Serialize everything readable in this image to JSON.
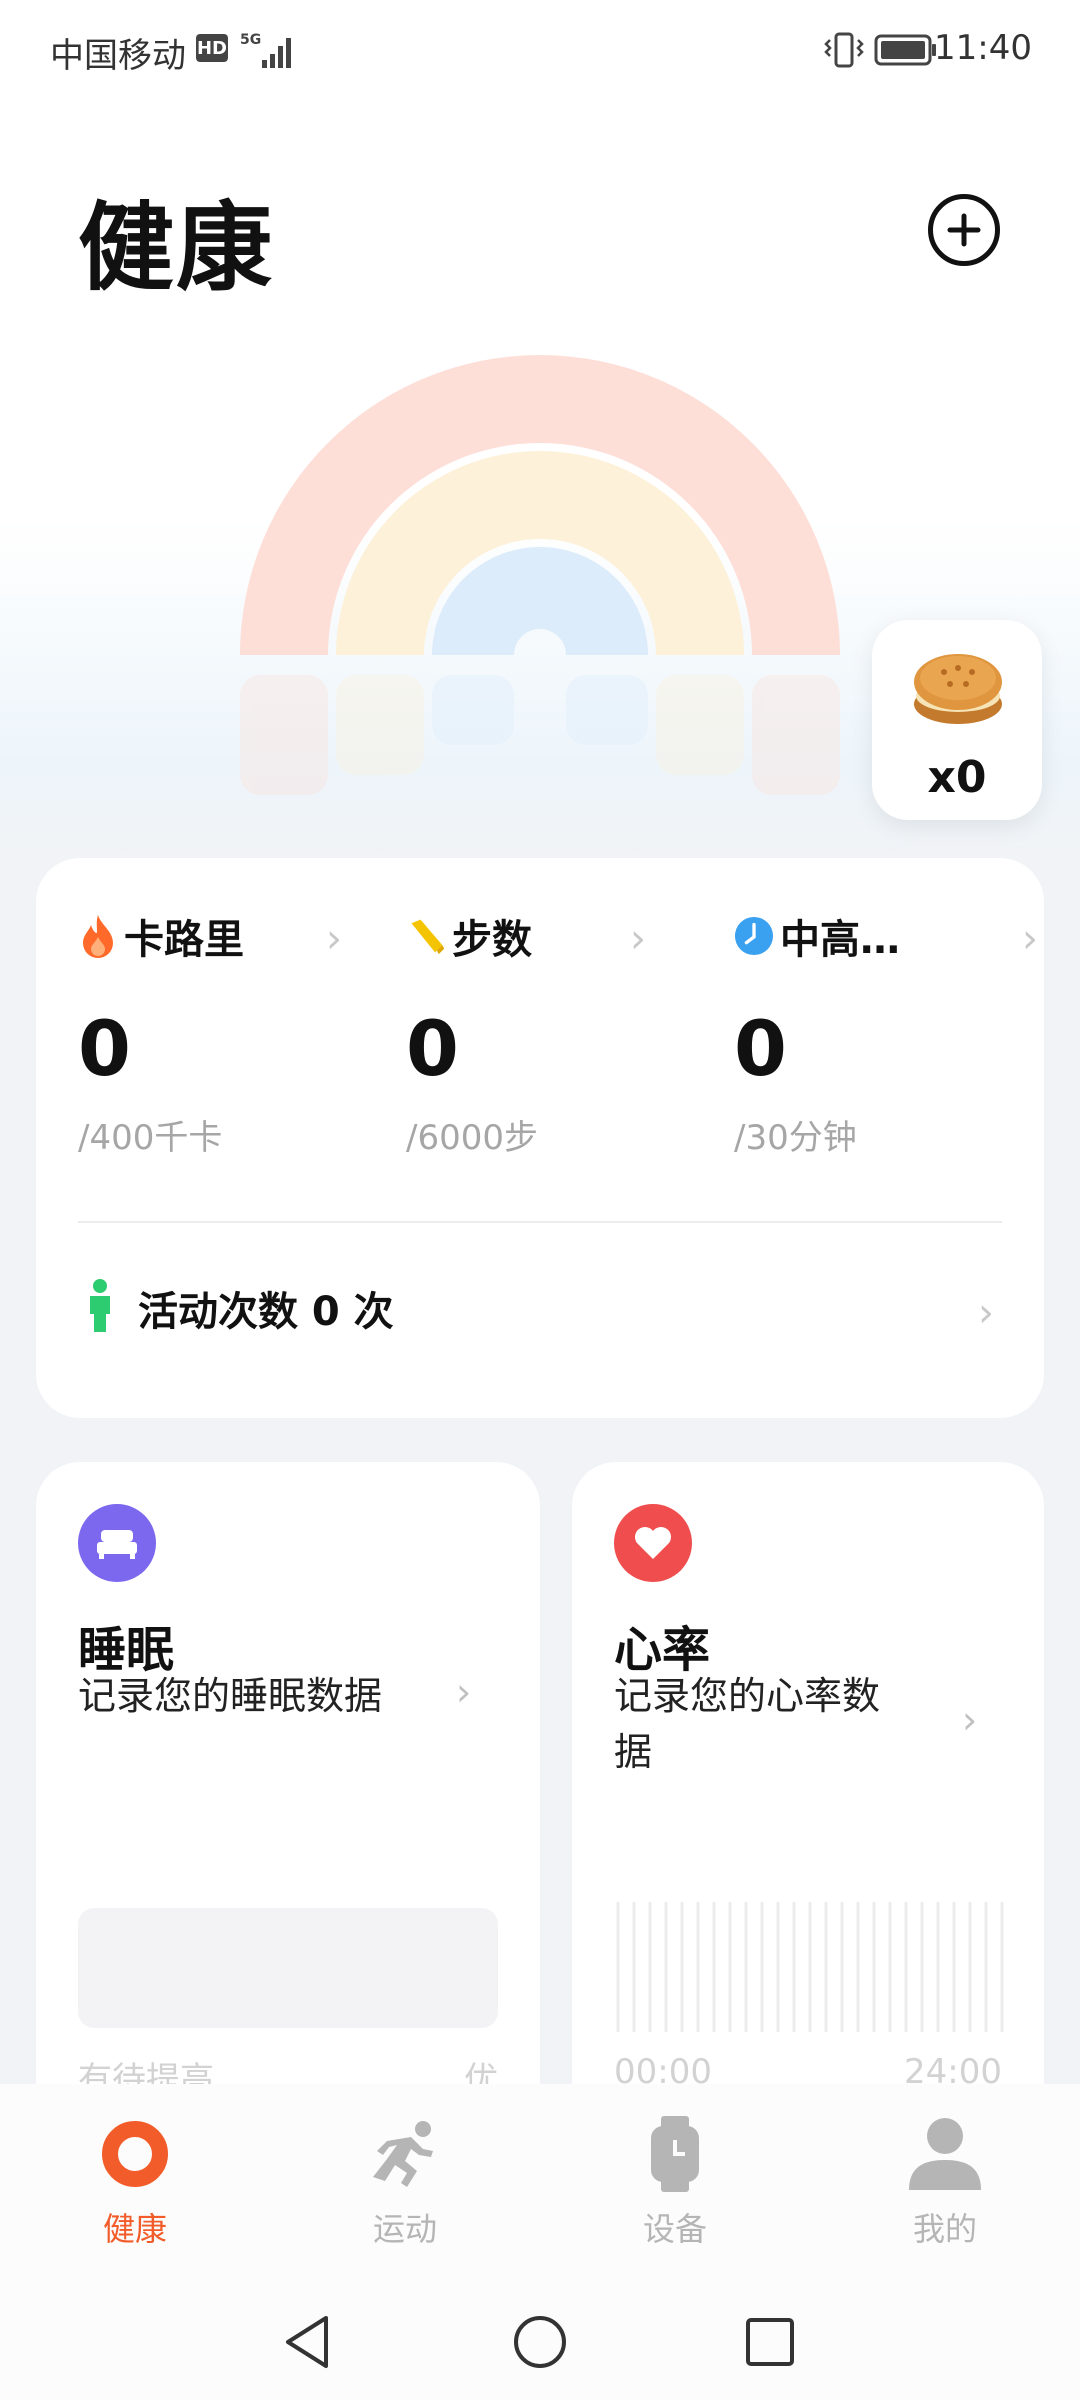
{
  "status_bar": {
    "carrier": "中国移动",
    "hd": "HD",
    "network": "5G",
    "time": "11:40"
  },
  "header": {
    "title": "健康"
  },
  "badge": {
    "count": "x0"
  },
  "activity": {
    "metrics": [
      {
        "label": "卡路里",
        "value": "0",
        "goal": "/400千卡"
      },
      {
        "label": "步数",
        "value": "0",
        "goal": "/6000步"
      },
      {
        "label": "中高…",
        "value": "0",
        "goal": "/30分钟"
      }
    ],
    "count_text": "活动次数 0 次"
  },
  "sleep": {
    "title": "睡眠",
    "desc": "记录您的睡眠数据",
    "low_label": "有待提高",
    "high_label": "优"
  },
  "heart": {
    "title": "心率",
    "desc_line1": "记录您的心率数",
    "desc_line2": "据",
    "start_label": "00:00",
    "end_label": "24:00"
  },
  "tabs": [
    {
      "label": "健康",
      "active": true
    },
    {
      "label": "运动",
      "active": false
    },
    {
      "label": "设备",
      "active": false
    },
    {
      "label": "我的",
      "active": false
    }
  ],
  "colors": {
    "accent": "#f25c2a",
    "calorie": "#ff6a2b",
    "steps": "#f5c400",
    "intensity": "#3aa0f0",
    "activity": "#2ecc71",
    "sleep": "#7b68ee",
    "heart": "#f04e4e",
    "tab_inactive": "#b5b5b5"
  },
  "icons": {
    "add": "plus-circle-icon",
    "calorie": "flame-icon",
    "steps": "shoe-icon",
    "intensity": "clock-icon",
    "activity": "person-icon",
    "sleep": "bed-icon",
    "heart": "heart-icon",
    "badge": "cookie-icon",
    "tab_health": "ring-icon",
    "tab_sport": "running-icon",
    "tab_device": "watch-icon",
    "tab_me": "person-icon",
    "nav_back": "triangle-back-icon",
    "nav_home": "circle-home-icon",
    "nav_recent": "square-recent-icon"
  }
}
